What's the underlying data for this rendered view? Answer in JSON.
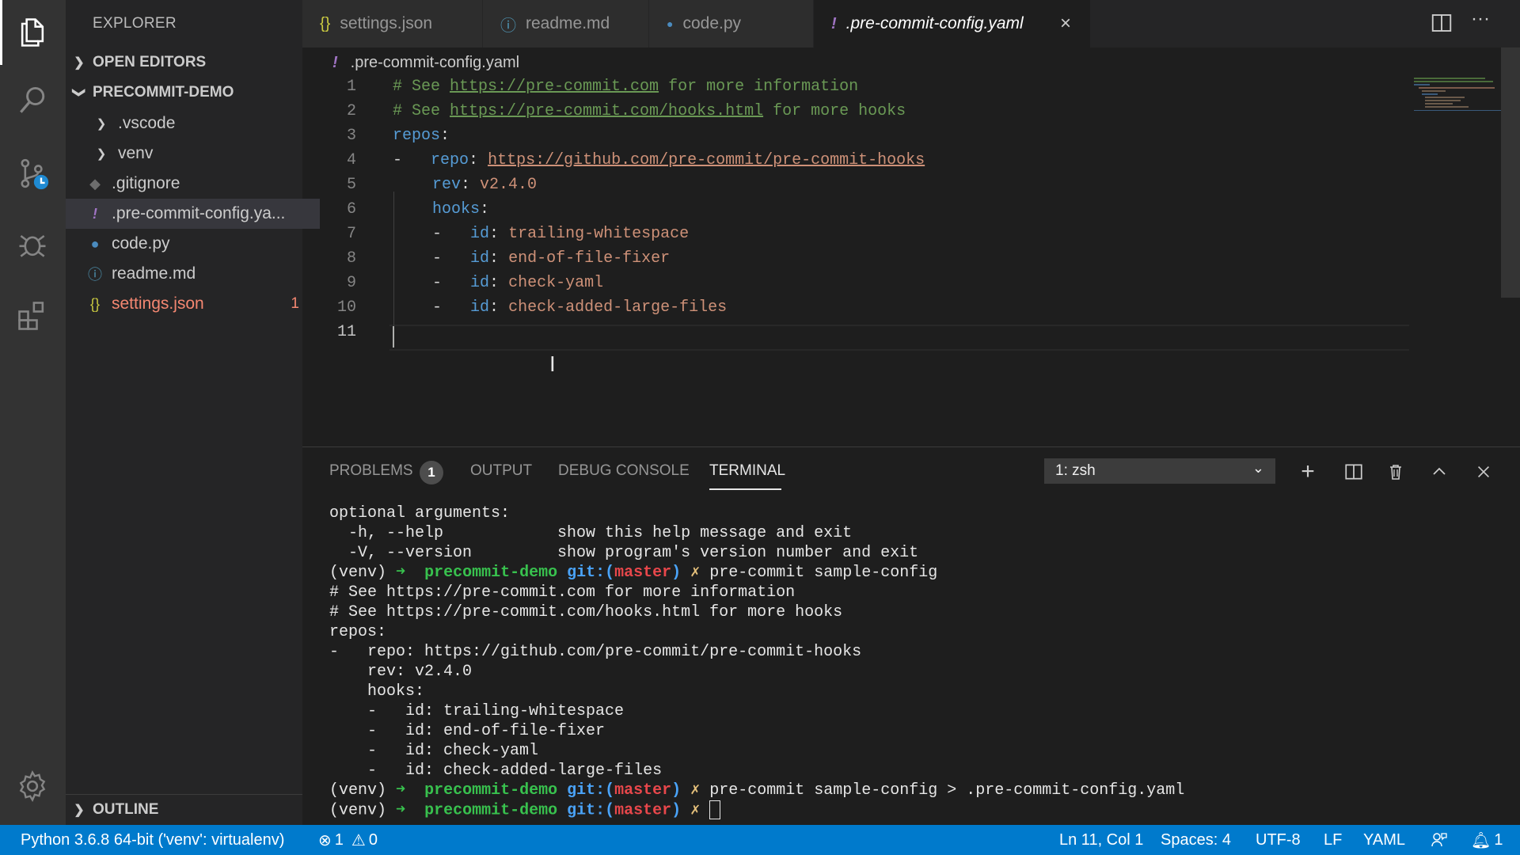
{
  "activity_bar": {
    "icons": [
      "explorer-icon",
      "search-icon",
      "source-control-icon",
      "debug-icon",
      "extensions-icon",
      "settings-gear-icon"
    ]
  },
  "sidebar": {
    "title": "EXPLORER",
    "open_editors": "OPEN EDITORS",
    "project": "PRECOMMIT-DEMO",
    "outline": "OUTLINE",
    "items": [
      {
        "label": ".vscode",
        "type": "folder"
      },
      {
        "label": "venv",
        "type": "folder"
      },
      {
        "label": ".gitignore",
        "type": "file"
      },
      {
        "label": ".pre-commit-config.ya...",
        "type": "file"
      },
      {
        "label": "code.py",
        "type": "file"
      },
      {
        "label": "readme.md",
        "type": "file"
      },
      {
        "label": "settings.json",
        "type": "file",
        "count": "1"
      }
    ]
  },
  "tabs": [
    {
      "label": "settings.json",
      "icon": "{}"
    },
    {
      "label": "readme.md",
      "icon": "ⓘ"
    },
    {
      "label": "code.py",
      "icon": "py"
    },
    {
      "label": ".pre-commit-config.yaml",
      "icon": "!"
    }
  ],
  "editor": {
    "breadcrumb": ".pre-commit-config.yaml",
    "line_numbers": [
      "1",
      "2",
      "3",
      "4",
      "5",
      "6",
      "7",
      "8",
      "9",
      "10",
      "11"
    ],
    "lines": {
      "l1_comment": "# See ",
      "l1_link": "https://pre-commit.com",
      "l1_tail": " for more information",
      "l2_comment": "# See ",
      "l2_link": "https://pre-commit.com/hooks.html",
      "l2_tail": " for more hooks",
      "l3_key": "repos",
      "l4_dash": "-   ",
      "l4_key": "repo",
      "l4_value": "https://github.com/pre-commit/pre-commit-hooks",
      "l5_key": "rev",
      "l5_value": "v2.4.0",
      "l6_key": "hooks",
      "hook_ids": [
        "trailing-whitespace",
        "end-of-file-fixer",
        "check-yaml",
        "check-added-large-files"
      ],
      "id_key": "id",
      "colon": ":",
      "hook_dash": "-   "
    }
  },
  "panel": {
    "tabs": [
      "PROBLEMS",
      "OUTPUT",
      "DEBUG CONSOLE",
      "TERMINAL"
    ],
    "problems_count": "1",
    "terminal_select": "1: zsh",
    "terminal_lines": [
      "optional arguments:",
      "  -h, --help            show this help message and exit",
      "  -V, --version         show program's version number and exit",
      "# See https://pre-commit.com for more information",
      "# See https://pre-commit.com/hooks.html for more hooks",
      "repos:",
      "-   repo: https://github.com/pre-commit/pre-commit-hooks",
      "    rev: v2.4.0",
      "    hooks:",
      "    -   id: trailing-whitespace",
      "    -   id: end-of-file-fixer",
      "    -   id: check-yaml",
      "    -   id: check-added-large-files"
    ],
    "prompt": {
      "venv": "(venv) ",
      "arrow": "➜  ",
      "dir": "precommit-demo",
      "git": " git:(",
      "branch": "master",
      "git_close": ")",
      "x": " ✗ ",
      "cmd1": "pre-commit sample-config",
      "cmd2": "pre-commit sample-config > .pre-commit-config.yaml"
    }
  },
  "status_bar": {
    "python": "Python 3.6.8 64-bit ('venv': virtualenv)",
    "errors": "1",
    "warnings": "0",
    "position": "Ln 11, Col 1",
    "spaces": "Spaces: 4",
    "encoding": "UTF-8",
    "eol": "LF",
    "language": "YAML",
    "notifications": "1"
  },
  "colors": {
    "accent": "#007acc",
    "yaml_key": "#569cd6",
    "yaml_string": "#ce9178",
    "comment": "#6a9955",
    "error": "#f48771"
  }
}
